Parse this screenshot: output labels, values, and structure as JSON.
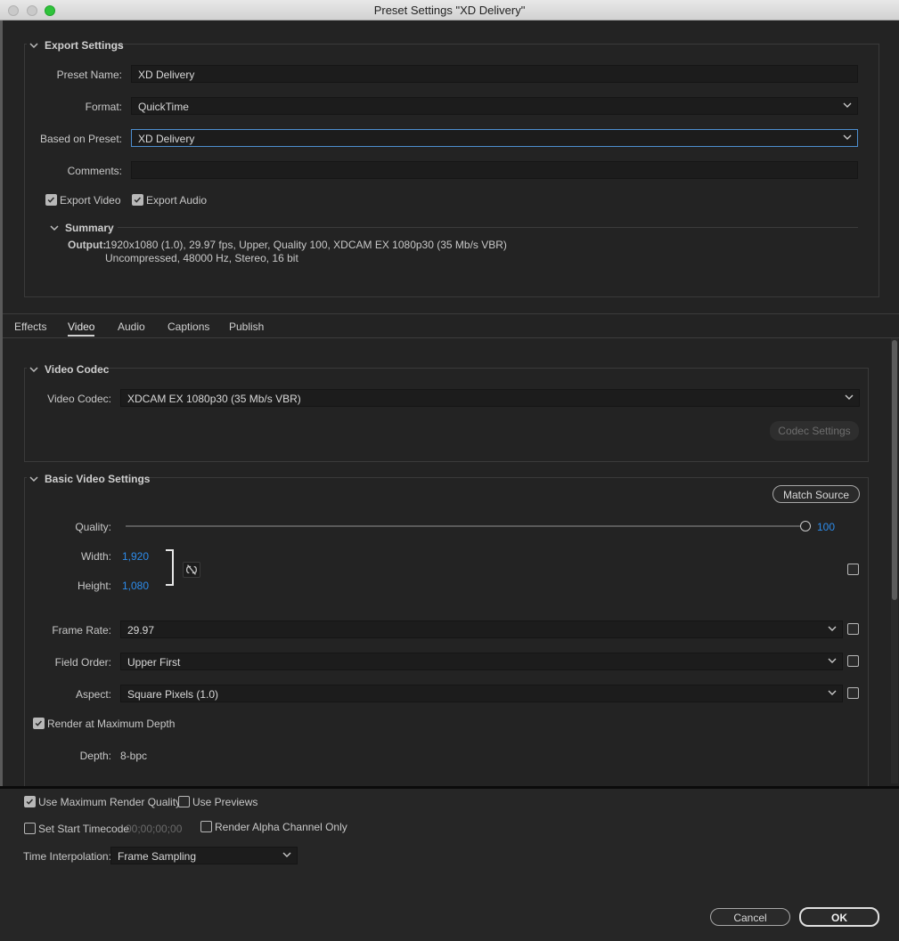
{
  "window": {
    "title": "Preset Settings \"XD Delivery\""
  },
  "export_settings": {
    "title": "Export Settings",
    "preset_name_label": "Preset Name:",
    "preset_name_value": "XD Delivery",
    "format_label": "Format:",
    "format_value": "QuickTime",
    "based_on_label": "Based on Preset:",
    "based_on_value": "XD Delivery",
    "comments_label": "Comments:",
    "comments_value": "",
    "export_video": "Export Video",
    "export_audio": "Export Audio",
    "summary_title": "Summary",
    "output_label": "Output:",
    "output_line1": "1920x1080 (1.0), 29.97 fps, Upper, Quality 100, XDCAM EX 1080p30 (35 Mb/s VBR)",
    "output_line2": "Uncompressed, 48000 Hz, Stereo, 16 bit"
  },
  "tabs": [
    {
      "label": "Effects"
    },
    {
      "label": "Video"
    },
    {
      "label": "Audio"
    },
    {
      "label": "Captions"
    },
    {
      "label": "Publish"
    }
  ],
  "video_codec": {
    "title": "Video Codec",
    "codec_label": "Video Codec:",
    "codec_value": "XDCAM EX 1080p30 (35 Mb/s VBR)",
    "codec_settings": "Codec Settings"
  },
  "basic_video": {
    "title": "Basic Video Settings",
    "match_source": "Match Source",
    "quality_label": "Quality:",
    "quality_value": "100",
    "width_label": "Width:",
    "width_value": "1,920",
    "height_label": "Height:",
    "height_value": "1,080",
    "frame_rate_label": "Frame Rate:",
    "frame_rate_value": "29.97",
    "field_order_label": "Field Order:",
    "field_order_value": "Upper First",
    "aspect_label": "Aspect:",
    "aspect_value": "Square Pixels (1.0)",
    "render_max_depth": "Render at Maximum Depth",
    "depth_label": "Depth:",
    "depth_value": "8-bpc"
  },
  "bottom": {
    "use_max_render_quality": "Use Maximum Render Quality",
    "use_previews": "Use Previews",
    "set_start_timecode": "Set Start Timecode",
    "timecode_value": "00;00;00;00",
    "render_alpha_only": "Render Alpha Channel Only",
    "time_interp_label": "Time Interpolation:",
    "time_interp_value": "Frame Sampling",
    "cancel": "Cancel",
    "ok": "OK"
  },
  "colors": {
    "accent_blue": "#2d8ceb",
    "background": "#232323",
    "focus_border": "#4d8ecf"
  }
}
